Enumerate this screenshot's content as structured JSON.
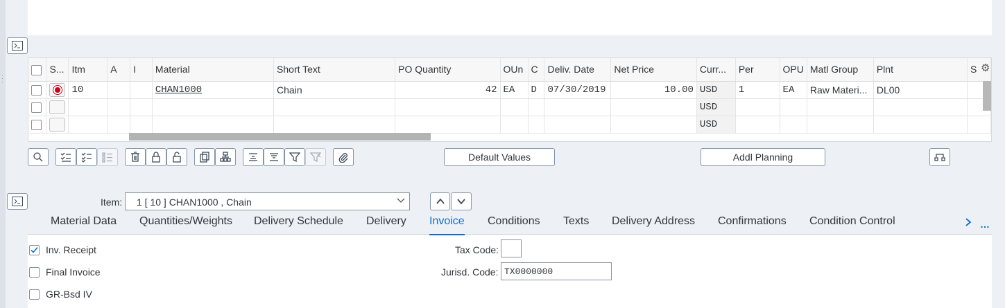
{
  "grid": {
    "headers": [
      "S...",
      "Itm",
      "A",
      "I",
      "Material",
      "Short Text",
      "PO Quantity",
      "OUn",
      "C",
      "Deliv. Date",
      "Net Price",
      "Curr...",
      "Per",
      "OPU",
      "Matl Group",
      "Plnt",
      "S"
    ],
    "rows": [
      {
        "itm": "10",
        "material": "CHAN1000",
        "short_text": "Chain",
        "po_qty": "42",
        "oun": "EA",
        "c": "D",
        "deliv_date": "07/30/2019",
        "net_price": "10.00",
        "curr": "USD",
        "per": "1",
        "opu": "EA",
        "matl_group": "Raw Materi...",
        "plnt": "DL00"
      },
      {
        "curr": "USD"
      },
      {
        "curr": "USD"
      }
    ]
  },
  "buttons": {
    "default_values": "Default Values",
    "addl_planning": "Addl Planning"
  },
  "item_selector": {
    "label": "Item:",
    "value": "1 [ 10 ] CHAN1000 , Chain"
  },
  "tabs": [
    "Material Data",
    "Quantities/Weights",
    "Delivery Schedule",
    "Delivery",
    "Invoice",
    "Conditions",
    "Texts",
    "Delivery Address",
    "Confirmations",
    "Condition Control"
  ],
  "active_tab": "Invoice",
  "invoice": {
    "inv_receipt_label": "Inv. Receipt",
    "inv_receipt_checked": true,
    "final_invoice_label": "Final Invoice",
    "gr_bsd_iv_label": "GR-Bsd IV",
    "tax_code_label": "Tax Code:",
    "tax_code_value": "",
    "jurisd_code_label": "Jurisd. Code:",
    "jurisd_code_value": "TX0000000"
  },
  "colors": {
    "accent": "#0a6ed1",
    "background": "#edf1f6",
    "error_red": "#d0021b"
  }
}
